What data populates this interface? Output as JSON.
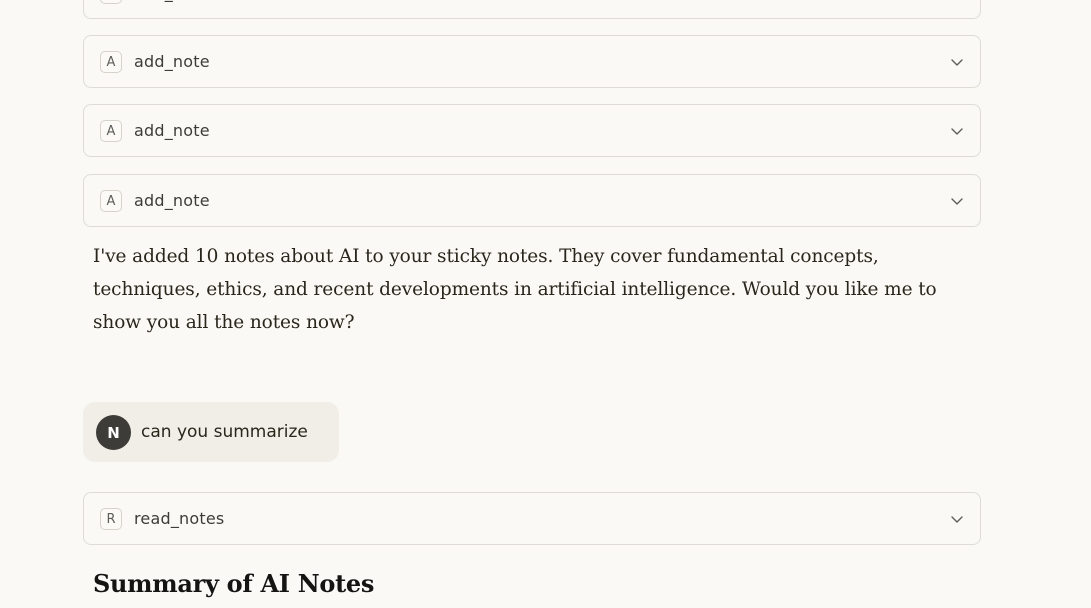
{
  "conversation": {
    "tool_calls_top": [
      {
        "badge": "A",
        "name": "add_note"
      },
      {
        "badge": "A",
        "name": "add_note"
      },
      {
        "badge": "A",
        "name": "add_note"
      },
      {
        "badge": "A",
        "name": "add_note"
      }
    ],
    "assistant_message": "I've added 10 notes about AI to your sticky notes. They cover fundamental concepts, techniques, ethics, and recent developments in artificial intelligence. Would you like me to show you all the notes now?",
    "user_message": {
      "avatar_initial": "N",
      "text": "can you summarize"
    },
    "tool_call_read": {
      "badge": "R",
      "name": "read_notes"
    },
    "summary_heading": "Summary of AI Notes"
  },
  "icons": {
    "expand": "chevron-down-icon"
  },
  "colors": {
    "background": "#faf9f5",
    "card_border": "#dedcd4",
    "user_bubble": "#f0eee6",
    "avatar": "#3d3c38"
  }
}
